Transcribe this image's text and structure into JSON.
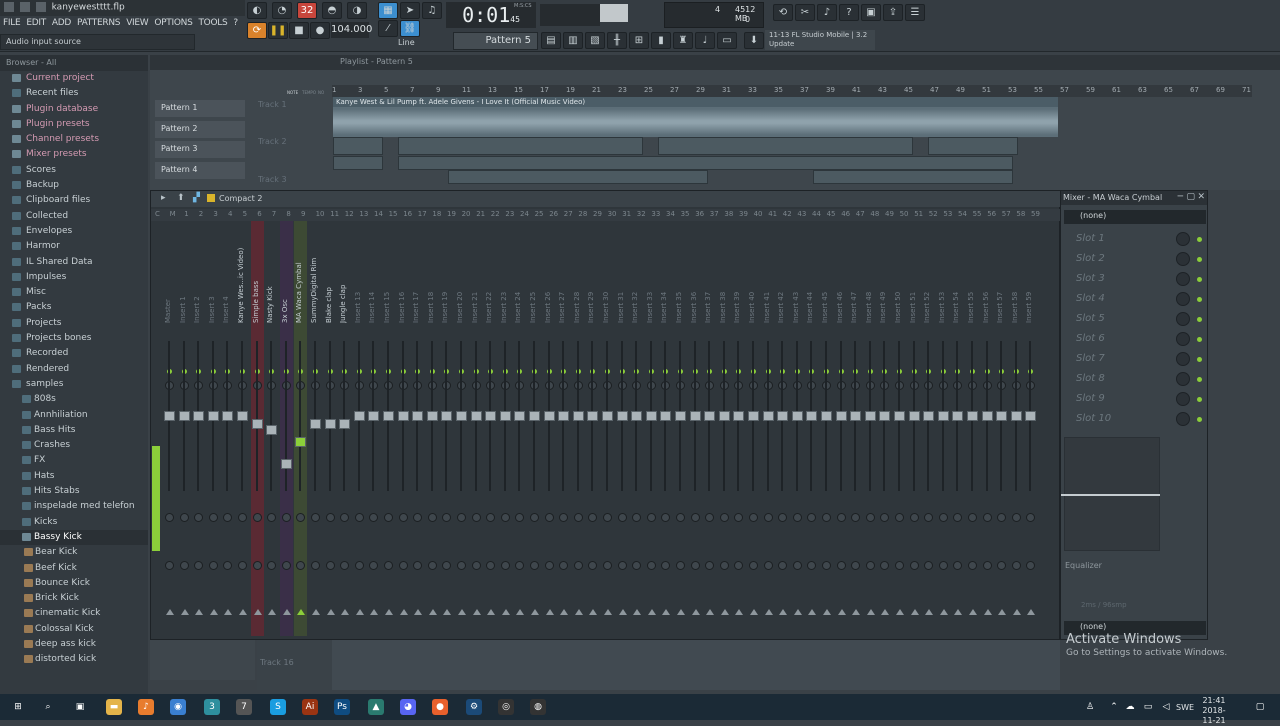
{
  "window": {
    "title": "kanyewestttt.flp"
  },
  "menu": [
    "FILE",
    "EDIT",
    "ADD",
    "PATTERNS",
    "VIEW",
    "OPTIONS",
    "TOOLS",
    "?"
  ],
  "hint": "Audio input source",
  "transport": {
    "time": "0:01",
    "time_frac": "45",
    "time_unit": "M:S:CS",
    "tempo": "104.000",
    "pattern": "Pattern 5",
    "snap": "Line",
    "step_label": "32"
  },
  "cpu": {
    "voices": "4",
    "memory": "4512 MB",
    "zero": "0"
  },
  "news": {
    "date": "11-13",
    "title": "FL Studio Mobile | 3.2",
    "body": "Update"
  },
  "browser": {
    "header": "Browser - All",
    "items": [
      {
        "label": "Current project",
        "style": "pink"
      },
      {
        "label": "Recent files",
        "style": "normal"
      },
      {
        "label": "Plugin database",
        "style": "pink"
      },
      {
        "label": "Plugin presets",
        "style": "pink"
      },
      {
        "label": "Channel presets",
        "style": "pink"
      },
      {
        "label": "Mixer presets",
        "style": "pink"
      },
      {
        "label": "Scores",
        "style": "normal"
      },
      {
        "label": "Backup",
        "style": "normal"
      },
      {
        "label": "Clipboard files",
        "style": "normal"
      },
      {
        "label": "Collected",
        "style": "normal"
      },
      {
        "label": "Envelopes",
        "style": "normal"
      },
      {
        "label": "Harmor",
        "style": "normal"
      },
      {
        "label": "IL Shared Data",
        "style": "normal"
      },
      {
        "label": "Impulses",
        "style": "normal"
      },
      {
        "label": "Misc",
        "style": "normal"
      },
      {
        "label": "Packs",
        "style": "normal"
      },
      {
        "label": "Projects",
        "style": "normal"
      },
      {
        "label": "Projects bones",
        "style": "normal"
      },
      {
        "label": "Recorded",
        "style": "normal"
      },
      {
        "label": "Rendered",
        "style": "normal"
      },
      {
        "label": "samples",
        "style": "open"
      },
      {
        "label": "808s",
        "style": "sub"
      },
      {
        "label": "Annhiliation",
        "style": "sub"
      },
      {
        "label": "Bass Hits",
        "style": "sub"
      },
      {
        "label": "Crashes",
        "style": "sub"
      },
      {
        "label": "FX",
        "style": "sub"
      },
      {
        "label": "Hats",
        "style": "sub"
      },
      {
        "label": "Hits Stabs",
        "style": "sub"
      },
      {
        "label": "inspelade med telefon",
        "style": "sub"
      },
      {
        "label": "Kicks",
        "style": "sub"
      },
      {
        "label": "Bassy Kick",
        "style": "sel"
      },
      {
        "label": "Bear Kick",
        "style": "sub2"
      },
      {
        "label": "Beef Kick",
        "style": "sub2"
      },
      {
        "label": "Bounce Kick",
        "style": "sub2"
      },
      {
        "label": "Brick Kick",
        "style": "sub2"
      },
      {
        "label": "cinematic Kick",
        "style": "sub2"
      },
      {
        "label": "Colossal Kick",
        "style": "sub2"
      },
      {
        "label": "deep ass kick",
        "style": "sub2"
      },
      {
        "label": "distorted kick",
        "style": "sub2"
      }
    ]
  },
  "playlist": {
    "title": "Playlist - Pattern 5",
    "patterns": [
      "Pattern 1",
      "Pattern 2",
      "Pattern 3",
      "Pattern 4"
    ],
    "tracks": [
      "Track 1",
      "Track 2",
      "Track 3"
    ],
    "bottom_track": "Track 16",
    "ruler": [
      "1",
      "3",
      "5",
      "7",
      "9",
      "11",
      "13",
      "15",
      "17",
      "19",
      "21",
      "23",
      "25",
      "27",
      "29",
      "31",
      "33",
      "35",
      "37",
      "39",
      "41",
      "43",
      "45",
      "47",
      "49",
      "51",
      "53",
      "55",
      "57",
      "59",
      "61",
      "63",
      "65",
      "67",
      "69",
      "71"
    ],
    "clip_label": "Kanye West & Lil Pump ft. Adele Givens - I Love It (Official Music Video)",
    "note_label": "NOTE",
    "tempo_label": "TEMPO",
    "mode_label": "NO"
  },
  "mixer": {
    "title": "Compact 2",
    "strips": [
      "Master",
      "Insert 1",
      "Insert 2",
      "Insert 3",
      "Insert 4",
      "Kanye Wes...ic Video)",
      "Simple bass",
      "Nasty Kick",
      "3x Osc",
      "MA Waca Cymbal",
      "SummyDigital Rim",
      "Blake clap",
      "Jungle clap",
      "Insert 13",
      "Insert 14",
      "Insert 15",
      "Insert 16",
      "Insert 17",
      "Insert 18",
      "Insert 19",
      "Insert 20",
      "Insert 21",
      "Insert 22",
      "Insert 23",
      "Insert 24",
      "Insert 25",
      "Insert 26",
      "Insert 27",
      "Insert 28",
      "Insert 29",
      "Insert 30",
      "Insert 31",
      "Insert 32",
      "Insert 33",
      "Insert 34",
      "Insert 35",
      "Insert 36",
      "Insert 37",
      "Insert 38",
      "Insert 39",
      "Insert 40",
      "Insert 41",
      "Insert 42",
      "Insert 43",
      "Insert 44",
      "Insert 45",
      "Insert 46",
      "Insert 47",
      "Insert 48",
      "Insert 49",
      "Insert 50",
      "Insert 51",
      "Insert 52",
      "Insert 53",
      "Insert 54",
      "Insert 55",
      "Insert 56",
      "Insert 57",
      "Insert 58",
      "Insert 59"
    ],
    "strip_numbers": [
      "C",
      "M",
      "1",
      "2",
      "3",
      "4",
      "5",
      "6",
      "7",
      "8",
      "9",
      "10",
      "11",
      "12",
      "13",
      "14",
      "15",
      "16",
      "17",
      "18",
      "19",
      "20",
      "21",
      "22",
      "23",
      "24",
      "25",
      "26",
      "27",
      "28",
      "29",
      "30",
      "31",
      "32",
      "33",
      "34",
      "35",
      "36",
      "37",
      "38",
      "39",
      "40",
      "41",
      "42",
      "43",
      "44",
      "45",
      "46",
      "47",
      "48",
      "49",
      "50",
      "51",
      "52",
      "53",
      "54",
      "55",
      "56",
      "57",
      "58",
      "59"
    ]
  },
  "insert_panel": {
    "title": "Mixer - MA Waca Cymbal",
    "input": "(none)",
    "slots": [
      "Slot 1",
      "Slot 2",
      "Slot 3",
      "Slot 4",
      "Slot 5",
      "Slot 6",
      "Slot 7",
      "Slot 8",
      "Slot 9",
      "Slot 10"
    ],
    "eq_label": "Equalizer",
    "latency": "2ms / 96smp",
    "output": "(none)"
  },
  "watermark": {
    "title": "Activate Windows",
    "body": "Go to Settings to activate Windows."
  },
  "taskbar": {
    "lang": "SWE",
    "time": "21:41",
    "date": "2018-11-21"
  },
  "colors": {
    "accent_green": "#8ccf3a",
    "track_red": "#5a2a33",
    "track_purple": "#3a2f48"
  }
}
